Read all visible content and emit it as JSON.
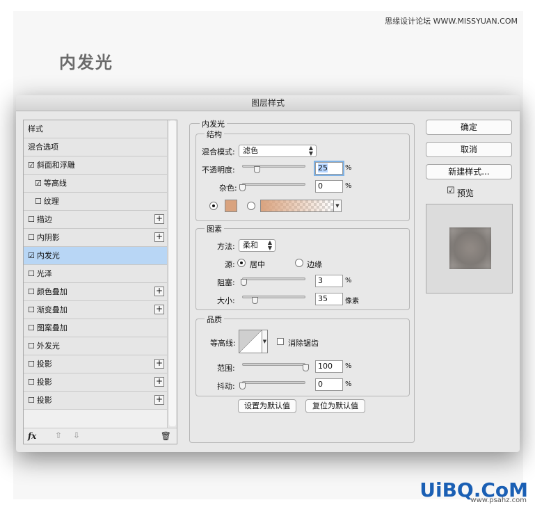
{
  "header": {
    "watermark": "思缘设计论坛 WWW.MISSYUAN.COM",
    "title": "内发光"
  },
  "dialog": {
    "title": "图层样式",
    "sidebar": {
      "items": [
        {
          "label": "样式"
        },
        {
          "label": "混合选项"
        },
        {
          "label": "斜面和浮雕",
          "check": "☑"
        },
        {
          "label": "等高线",
          "check": "☑"
        },
        {
          "label": "纹理",
          "check": "☐"
        },
        {
          "label": "描边",
          "check": "☐",
          "plus": "+"
        },
        {
          "label": "内阴影",
          "check": "☐",
          "plus": "+"
        },
        {
          "label": "内发光",
          "check": "☑"
        },
        {
          "label": "光泽",
          "check": "☐"
        },
        {
          "label": "颜色叠加",
          "check": "☐",
          "plus": "+"
        },
        {
          "label": "渐变叠加",
          "check": "☐",
          "plus": "+"
        },
        {
          "label": "图案叠加",
          "check": "☐"
        },
        {
          "label": "外发光",
          "check": "☐"
        },
        {
          "label": "投影",
          "check": "☐",
          "plus": "+"
        },
        {
          "label": "投影",
          "check": "☐",
          "plus": "+"
        },
        {
          "label": "投影",
          "check": "☐",
          "plus": "+"
        }
      ],
      "footer": {
        "fx": "fx",
        "up": "⇧",
        "down": "⇩",
        "trash": "🗑"
      }
    },
    "main": {
      "section_title": "内发光",
      "structure": {
        "legend": "结构",
        "blend_mode_label": "混合模式:",
        "blend_mode_value": "滤色",
        "opacity_label": "不透明度:",
        "opacity_value": "25",
        "noise_label": "杂色:",
        "noise_value": "0",
        "unit_percent": "%",
        "glow_color": "#d9a37f"
      },
      "elements": {
        "legend": "图素",
        "technique_label": "方法:",
        "technique_value": "柔和",
        "source_label": "源:",
        "source_center": "居中",
        "source_edge": "边缘",
        "choke_label": "阻塞:",
        "choke_value": "3",
        "size_label": "大小:",
        "size_value": "35",
        "size_unit": "像素"
      },
      "quality": {
        "legend": "品质",
        "contour_label": "等高线:",
        "antialias_label": "消除锯齿",
        "range_label": "范围:",
        "range_value": "100",
        "jitter_label": "抖动:",
        "jitter_value": "0"
      },
      "buttons": {
        "make_default": "设置为默认值",
        "reset_default": "复位为默认值"
      }
    },
    "right": {
      "ok": "确定",
      "cancel": "取消",
      "new_style": "新建样式...",
      "preview_label": "预览",
      "preview_check": "☑"
    }
  },
  "watermark_bottom": {
    "logo": "UiBQ.CoM",
    "url": "www.psahz.com"
  }
}
